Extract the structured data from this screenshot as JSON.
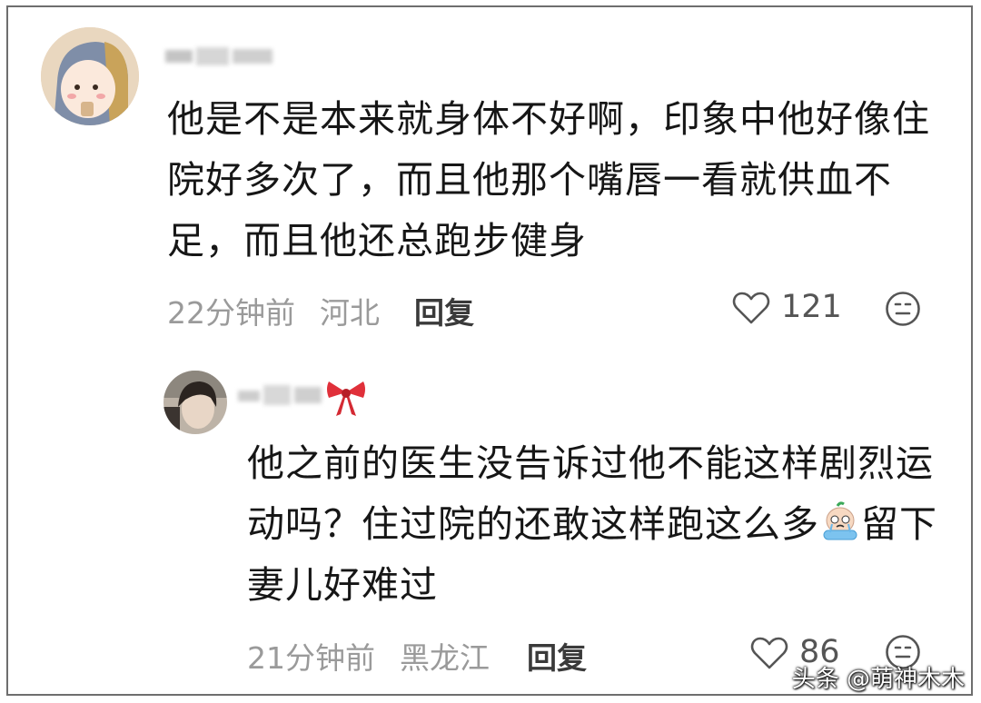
{
  "comment": {
    "text_lines": [
      "他是不是本来就身体不好啊，印象中他好像住",
      "院好多次了，而且他那个嘴唇一看就供血不",
      "足，而且他还总跑步健身"
    ],
    "time": "22分钟前",
    "location": "河北",
    "reply_label": "回复",
    "likes": "121"
  },
  "reply": {
    "text_lines": [
      "他之前的医生没告诉过他不能这样剧烈运",
      "动吗？住过院的还敢这样跑这么多",
      "妻儿好难过"
    ],
    "tail_after_emoji": "留下",
    "time": "21分钟前",
    "location": "黑龙江",
    "reply_label": "回复",
    "likes": "86"
  },
  "watermark": "头条 @萌神木木",
  "colors": {
    "meta_gray": "#9a9a9a",
    "bow_red": "#e0303a",
    "border": "#6e6e6e"
  },
  "icons": [
    "heart-outline-icon",
    "emoji-face-icon",
    "bow-badge-icon",
    "crying-emoji-icon"
  ]
}
